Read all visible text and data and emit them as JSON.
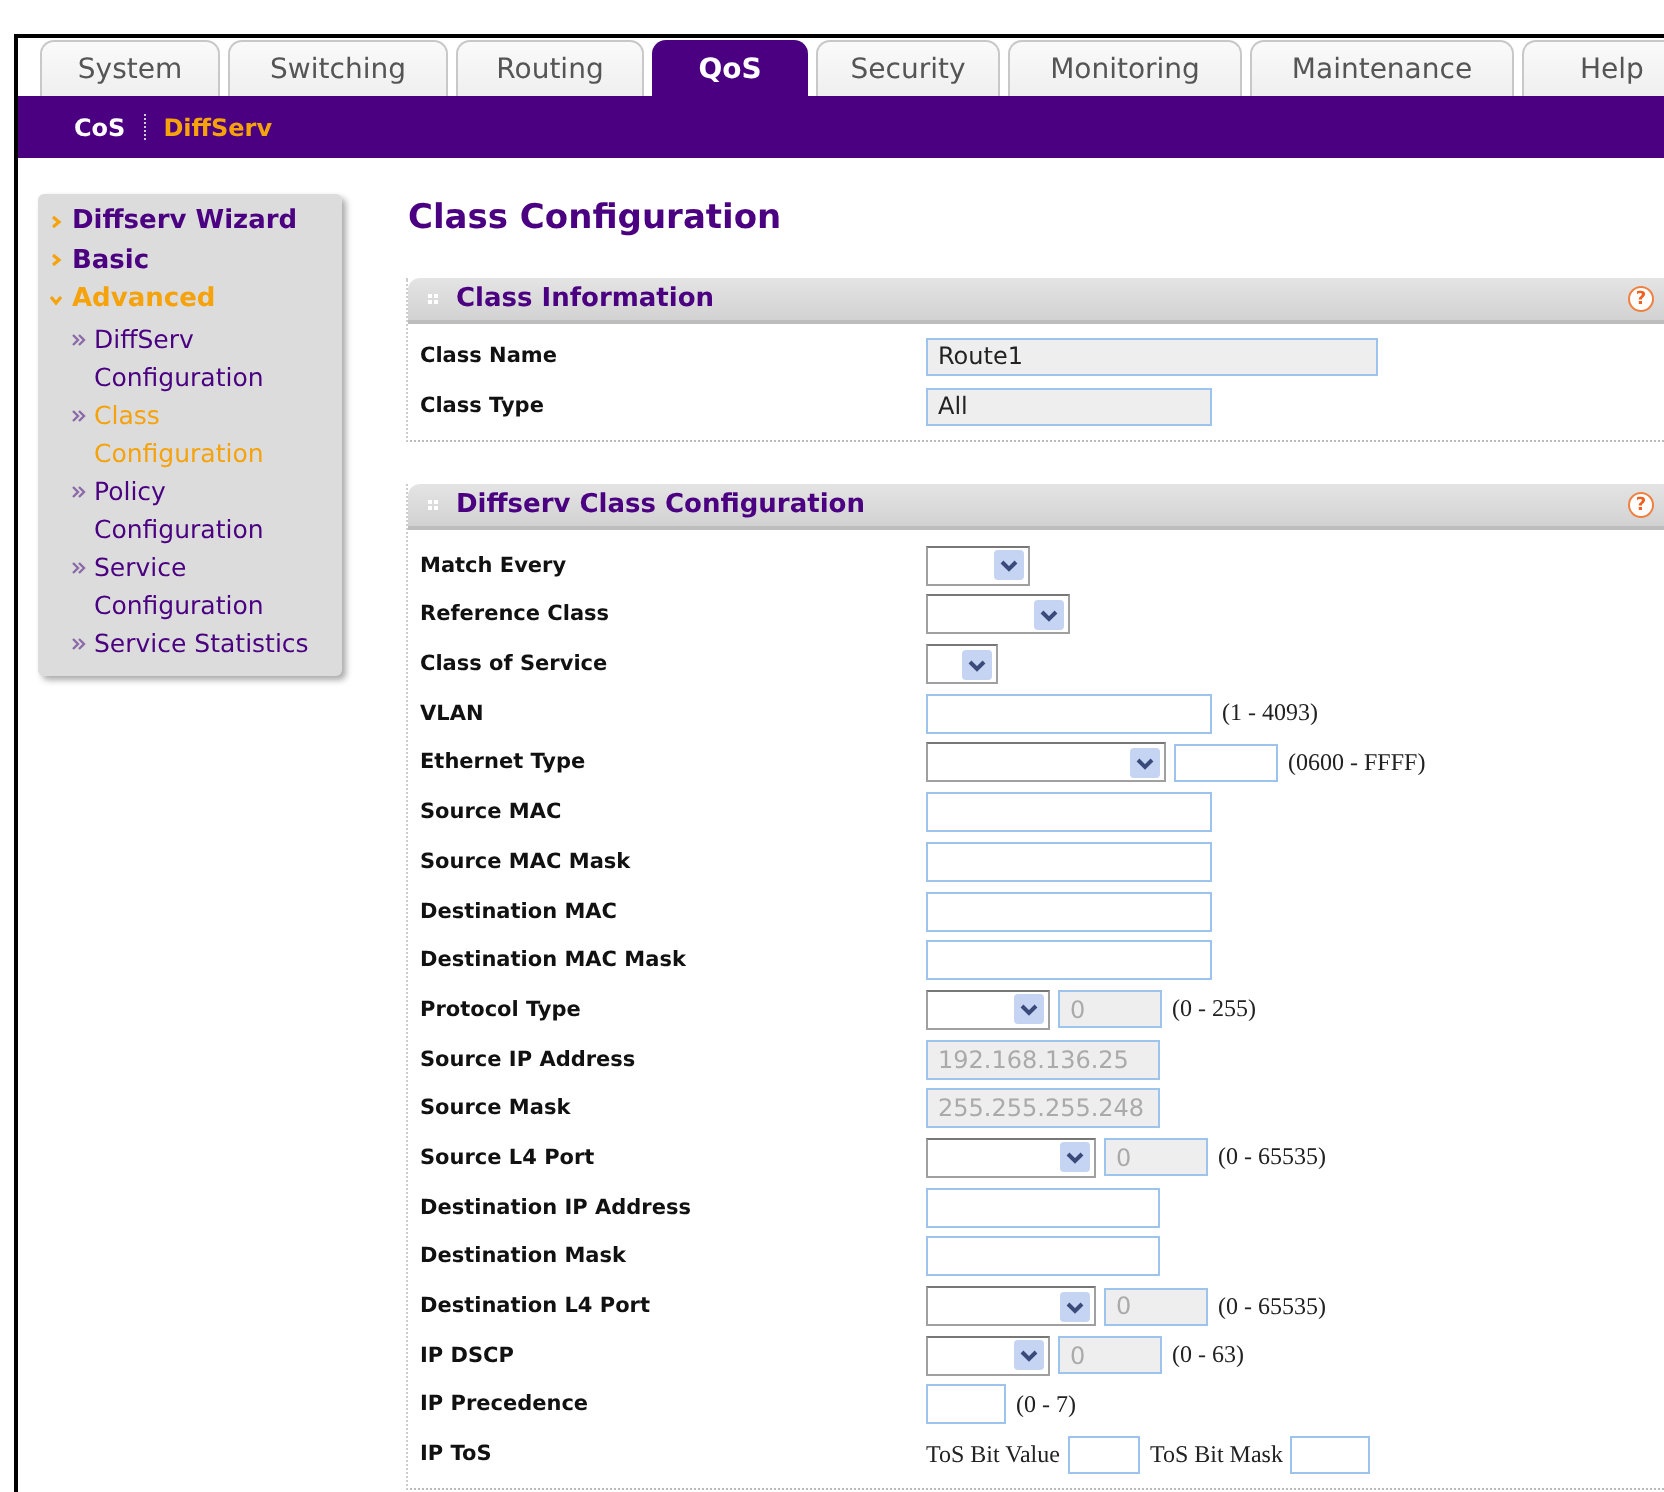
{
  "tabs": [
    {
      "label": "System",
      "selected": false
    },
    {
      "label": "Switching",
      "selected": false
    },
    {
      "label": "Routing",
      "selected": false
    },
    {
      "label": "QoS",
      "selected": true
    },
    {
      "label": "Security",
      "selected": false
    },
    {
      "label": "Monitoring",
      "selected": false
    },
    {
      "label": "Maintenance",
      "selected": false
    },
    {
      "label": "Help",
      "selected": false
    }
  ],
  "subnav": [
    {
      "label": "CoS",
      "selected": false
    },
    {
      "label": "DiffServ",
      "selected": true
    }
  ],
  "sidebar": {
    "items": [
      {
        "label": "Diffserv Wizard",
        "expanded": false,
        "selected": false
      },
      {
        "label": "Basic",
        "expanded": false,
        "selected": false
      },
      {
        "label": "Advanced",
        "expanded": true,
        "selected": true,
        "children": [
          {
            "label": "DiffServ Configuration",
            "selected": false
          },
          {
            "label": "Class Configuration",
            "selected": true
          },
          {
            "label": "Policy Configuration",
            "selected": false
          },
          {
            "label": "Service Configuration",
            "selected": false
          },
          {
            "label": "Service Statistics",
            "selected": false
          }
        ]
      }
    ]
  },
  "page_title": "Class Configuration",
  "sections": [
    {
      "title": "Class Information",
      "help": "?",
      "rows": [
        {
          "label": "Class Name",
          "controls": [
            {
              "kind": "input",
              "value": "Route1",
              "disabled": false,
              "readonly": true
            }
          ]
        },
        {
          "label": "Class Type",
          "controls": [
            {
              "kind": "input",
              "value": "All",
              "disabled": false,
              "readonly": true
            }
          ]
        }
      ]
    },
    {
      "title": "Diffserv Class Configuration",
      "help": "?",
      "rows": [
        {
          "label": "Match Every",
          "controls": [
            {
              "kind": "select"
            }
          ]
        },
        {
          "label": "Reference Class",
          "controls": [
            {
              "kind": "select"
            }
          ]
        },
        {
          "label": "Class of Service",
          "controls": [
            {
              "kind": "select"
            }
          ]
        },
        {
          "label": "VLAN",
          "controls": [
            {
              "kind": "input",
              "disabled": false
            },
            {
              "kind": "text",
              "text": "(1 - 4093)"
            }
          ]
        },
        {
          "label": "Ethernet Type",
          "controls": [
            {
              "kind": "select"
            },
            {
              "kind": "input",
              "disabled": false
            },
            {
              "kind": "text",
              "text": "(0600 - FFFF)"
            }
          ]
        },
        {
          "label": "Source MAC",
          "controls": [
            {
              "kind": "input",
              "disabled": false
            }
          ]
        },
        {
          "label": "Source MAC Mask",
          "controls": [
            {
              "kind": "input",
              "disabled": false
            }
          ]
        },
        {
          "label": "Destination MAC",
          "controls": [
            {
              "kind": "input",
              "disabled": false
            }
          ]
        },
        {
          "label": "Destination MAC Mask",
          "controls": [
            {
              "kind": "input",
              "disabled": false
            }
          ]
        },
        {
          "label": "Protocol Type",
          "controls": [
            {
              "kind": "select"
            },
            {
              "kind": "input",
              "value": "0",
              "disabled": true
            },
            {
              "kind": "text",
              "text": "(0 - 255)"
            }
          ]
        },
        {
          "label": "Source IP Address",
          "controls": [
            {
              "kind": "input",
              "value": "192.168.136.25",
              "disabled": true
            }
          ]
        },
        {
          "label": "Source Mask",
          "controls": [
            {
              "kind": "input",
              "value": "255.255.255.248",
              "disabled": true
            }
          ]
        },
        {
          "label": "Source L4 Port",
          "controls": [
            {
              "kind": "select"
            },
            {
              "kind": "input",
              "value": "0",
              "disabled": true
            },
            {
              "kind": "text",
              "text": "(0 - 65535)"
            }
          ]
        },
        {
          "label": "Destination IP Address",
          "controls": [
            {
              "kind": "input",
              "disabled": false
            }
          ]
        },
        {
          "label": "Destination Mask",
          "controls": [
            {
              "kind": "input",
              "disabled": false
            }
          ]
        },
        {
          "label": "Destination L4 Port",
          "controls": [
            {
              "kind": "select"
            },
            {
              "kind": "input",
              "value": "0",
              "disabled": true
            },
            {
              "kind": "text",
              "text": "(0 - 65535)"
            }
          ]
        },
        {
          "label": "IP DSCP",
          "controls": [
            {
              "kind": "select"
            },
            {
              "kind": "input",
              "value": "0",
              "disabled": true
            },
            {
              "kind": "text",
              "text": "(0 - 63)"
            }
          ]
        },
        {
          "label": "IP Precedence",
          "controls": [
            {
              "kind": "input",
              "disabled": false
            },
            {
              "kind": "text",
              "text": "(0 - 7)"
            }
          ]
        },
        {
          "label": "IP ToS",
          "controls": [
            {
              "kind": "text",
              "text": "ToS Bit Value"
            },
            {
              "kind": "input",
              "disabled": false
            },
            {
              "kind": "text",
              "text": "ToS Bit Mask"
            },
            {
              "kind": "input",
              "disabled": false
            }
          ]
        }
      ]
    }
  ]
}
